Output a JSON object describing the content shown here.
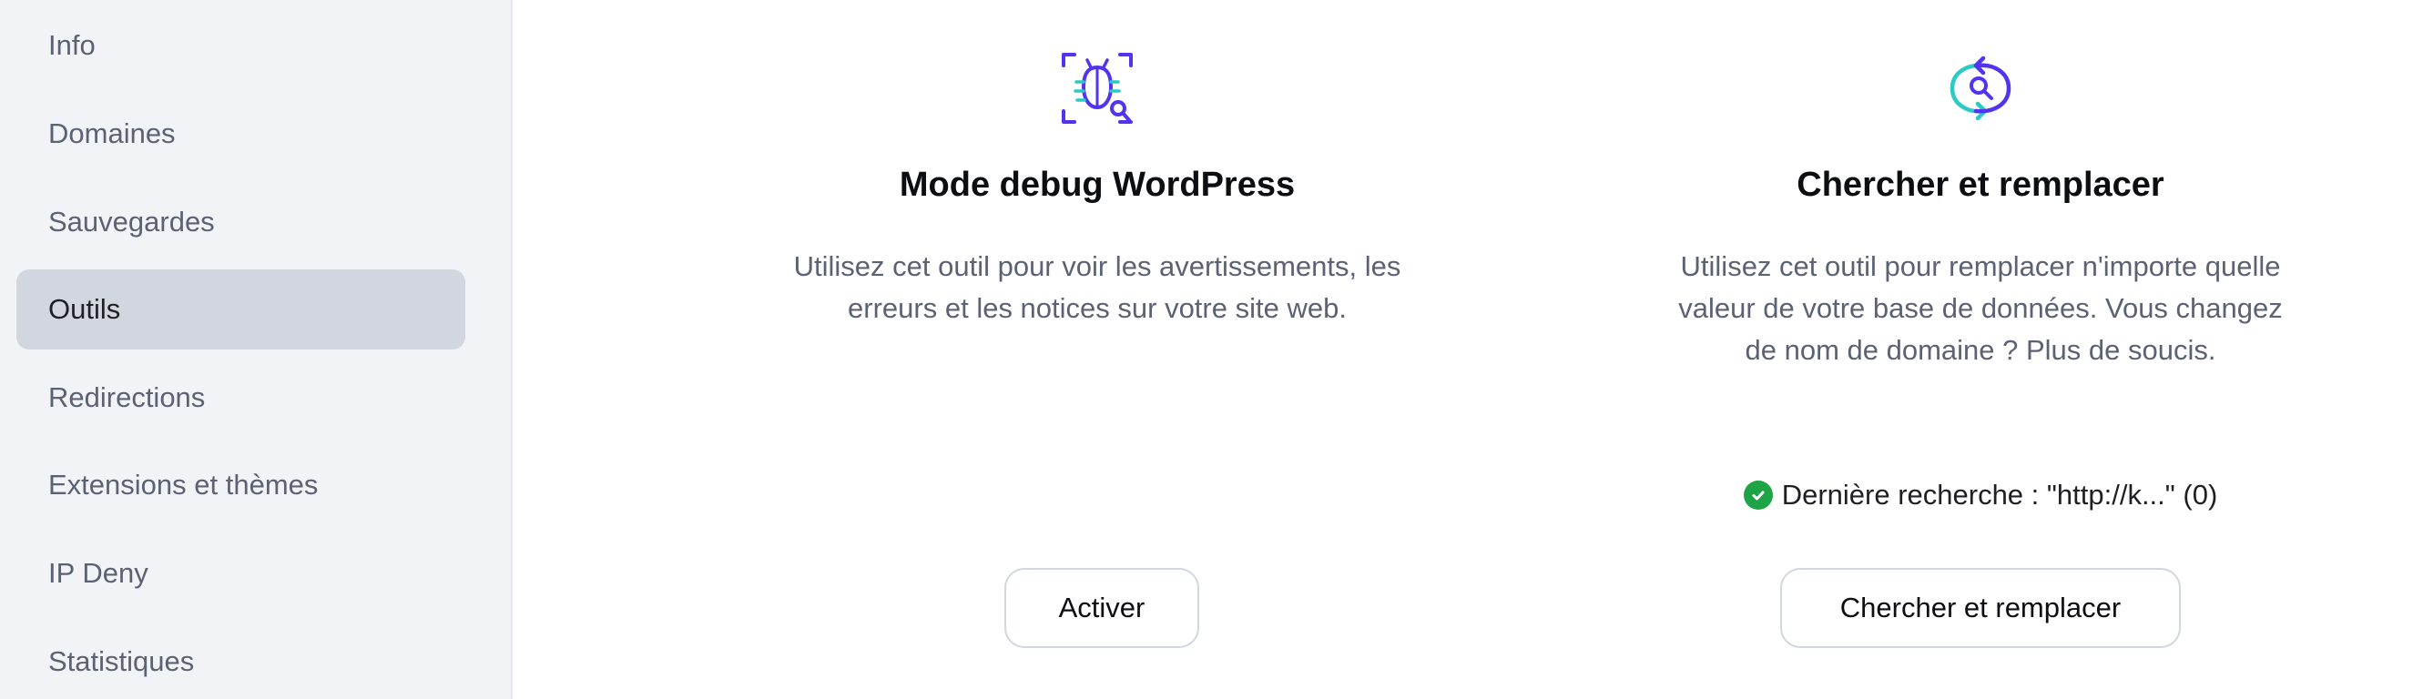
{
  "sidebar": {
    "items": [
      {
        "label": "Info",
        "active": false
      },
      {
        "label": "Domaines",
        "active": false
      },
      {
        "label": "Sauvegardes",
        "active": false
      },
      {
        "label": "Outils",
        "active": true
      },
      {
        "label": "Redirections",
        "active": false
      },
      {
        "label": "Extensions et thèmes",
        "active": false
      },
      {
        "label": "IP Deny",
        "active": false
      },
      {
        "label": "Statistiques",
        "active": false
      }
    ]
  },
  "tools": {
    "debug": {
      "icon": "bug-magnifier-icon",
      "title": "Mode debug WordPress",
      "description": "Utilisez cet outil pour voir les avertissements, les erreurs et les notices sur votre site web.",
      "button_label": "Activer"
    },
    "search_replace": {
      "icon": "search-replace-icon",
      "title": "Chercher et remplacer",
      "description": "Utilisez cet outil pour remplacer n'importe quelle valeur de votre base de données. Vous changez de nom de domaine ? Plus de soucis.",
      "status_text": "Dernière recherche : \"http://k...\" (0)",
      "button_label": "Chercher et remplacer"
    }
  },
  "colors": {
    "accent_purple": "#5333ed",
    "accent_teal": "#2bcac4",
    "success_green": "#1ea446",
    "active_item_bg": "#d2d6df"
  }
}
